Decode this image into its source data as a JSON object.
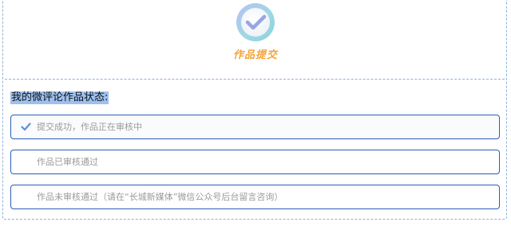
{
  "header": {
    "badge_icon": "check-circle-icon",
    "submit_title": "作品提交"
  },
  "section": {
    "title": "我的微评论作品状态:"
  },
  "statuses": [
    {
      "label": "提交成功，作品正在审核中",
      "checked": true
    },
    {
      "label": "作品已审核通过",
      "checked": false
    },
    {
      "label": "作品未审核通过（请在“长城新媒体”微信公众号后台留言咨询）",
      "checked": false
    }
  ],
  "colors": {
    "frame_dash": "#8fb0d6",
    "box_border": "#2a5cb8",
    "title_orange": "#f4a43a",
    "highlight": "#9ec0ef",
    "status_text": "#9a9a9a"
  }
}
